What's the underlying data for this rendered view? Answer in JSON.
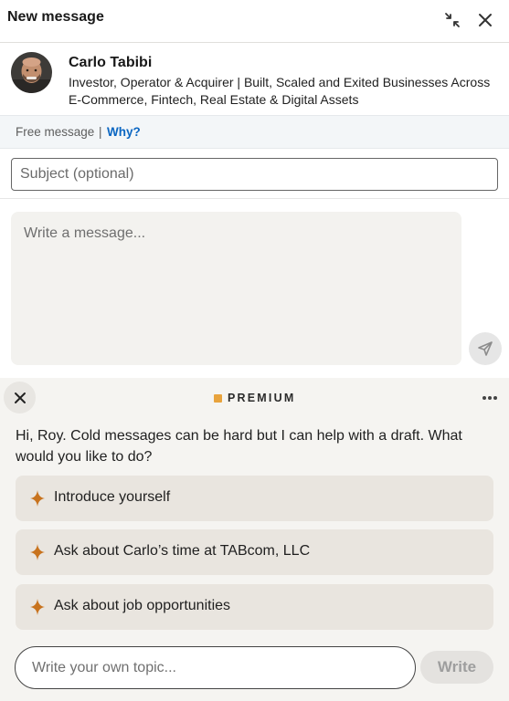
{
  "header": {
    "title": "New message",
    "minimize_icon": "collapse-arrows-icon",
    "close_icon": "close-icon"
  },
  "recipient": {
    "name": "Carlo Tabibi",
    "headline": "Investor, Operator & Acquirer | Built, Scaled and Exited Businesses Across E-Commerce, Fintech, Real Estate & Digital Assets"
  },
  "free_message": {
    "label": "Free message",
    "separator": "|",
    "why_link": "Why?"
  },
  "compose": {
    "subject_placeholder": "Subject (optional)",
    "message_placeholder": "Write a message...",
    "send_icon": "paper-plane-icon"
  },
  "premium": {
    "badge": "PREMIUM",
    "accent_color": "#e8a33d",
    "intro": "Hi, Roy. Cold messages can be hard but I can help with a draft. What would you like to do?",
    "suggestions": [
      {
        "label": "Introduce yourself",
        "icon": "sparkle-icon"
      },
      {
        "label": "Ask about Carlo’s time at TABcom, LLC",
        "icon": "sparkle-icon"
      },
      {
        "label": "Ask about job opportunities",
        "icon": "sparkle-icon"
      }
    ],
    "topic_placeholder": "Write your own topic...",
    "write_button": "Write"
  },
  "colors": {
    "link": "#0a66c2",
    "sparkle": "#c8731e"
  }
}
